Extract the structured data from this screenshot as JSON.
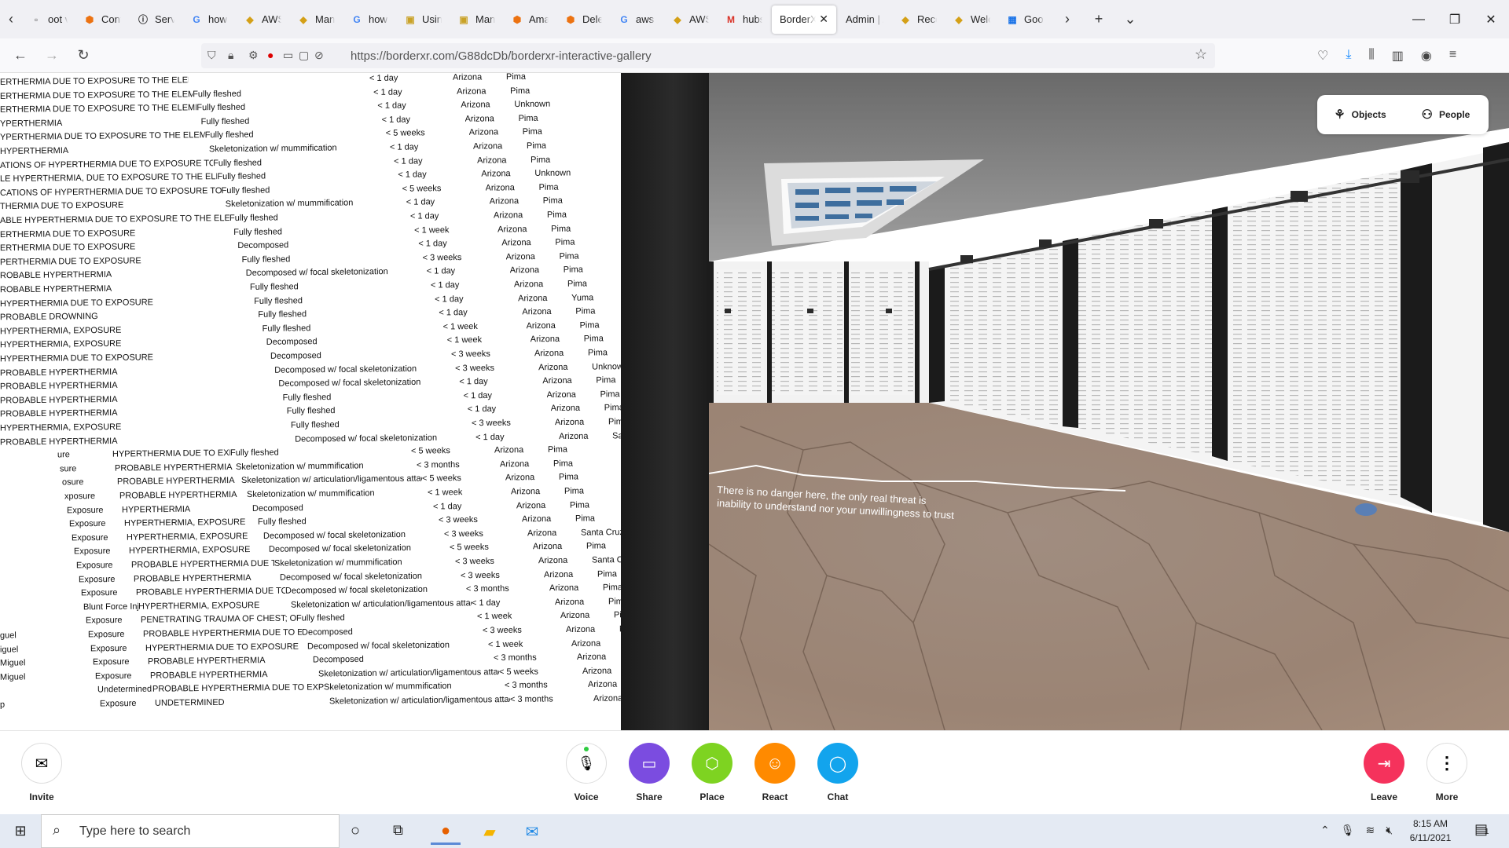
{
  "browser": {
    "tabs": [
      {
        "label": "oot v",
        "icon": "page-icon",
        "color": "#555"
      },
      {
        "label": "Conte",
        "icon": "aws-cube-icon",
        "color": "#ec7211"
      },
      {
        "label": "Server",
        "icon": "info-icon",
        "color": "#333"
      },
      {
        "label": "how t",
        "icon": "google-icon",
        "color": "#4285f4"
      },
      {
        "label": "AWS T",
        "icon": "bird-icon",
        "color": "#d4a017"
      },
      {
        "label": "Mana",
        "icon": "bird-icon",
        "color": "#d4a017"
      },
      {
        "label": "how t",
        "icon": "google-icon",
        "color": "#4285f4"
      },
      {
        "label": "Using",
        "icon": "book-icon",
        "color": "#c9a227"
      },
      {
        "label": "Manag",
        "icon": "book-icon",
        "color": "#c9a227"
      },
      {
        "label": "Amaz",
        "icon": "aws-cube-icon",
        "color": "#ec7211"
      },
      {
        "label": "Delete",
        "icon": "aws-cube-icon",
        "color": "#ec7211"
      },
      {
        "label": "aws cl",
        "icon": "google-icon",
        "color": "#4285f4"
      },
      {
        "label": "AWS T",
        "icon": "bird-icon",
        "color": "#d4a017"
      },
      {
        "label": "hubs",
        "icon": "gmail-icon",
        "color": "#d93025"
      },
      {
        "label": "BorderX",
        "icon": "none",
        "color": "#333",
        "active": true
      },
      {
        "label": "Admin | A",
        "icon": "none",
        "color": "#333"
      },
      {
        "label": "Recon",
        "icon": "bird-icon",
        "color": "#d4a017"
      },
      {
        "label": "Welco",
        "icon": "bird-icon",
        "color": "#d4a017"
      },
      {
        "label": "Googl",
        "icon": "calendar-icon",
        "color": "#1a73e8"
      }
    ],
    "url": "https://borderxr.com/G88dcDb/borderxr-interactive-gallery"
  },
  "listing": {
    "rows": [
      [
        "ERTHERMIA DUE TO EXPOSURE TO THE ELEMENTS",
        "",
        "< 1 day",
        "Arizona",
        "Pima"
      ],
      [
        "ERTHERMIA DUE TO EXPOSURE TO THE ELEMENTS",
        "Fully fleshed",
        "< 1 day",
        "Arizona",
        "Pima"
      ],
      [
        "ERTHERMIA DUE TO EXPOSURE TO THE ELEMENTS",
        "Fully fleshed",
        "< 1 day",
        "Arizona",
        "Unknown"
      ],
      [
        "YPERTHERMIA",
        "Fully fleshed",
        "< 1 day",
        "Arizona",
        "Pima"
      ],
      [
        "YPERTHERMIA DUE TO EXPOSURE TO THE ELEMENTS",
        "Fully fleshed",
        "< 5 weeks",
        "Arizona",
        "Pima"
      ],
      [
        "HYPERTHERMIA",
        "Skeletonization w/ mummification",
        "< 1 day",
        "Arizona",
        "Pima"
      ],
      [
        "ATIONS OF HYPERTHERMIA DUE TO EXPOSURE TO THE ELEM",
        "Fully fleshed",
        "< 1 day",
        "Arizona",
        "Pima"
      ],
      [
        "LE HYPERTHERMIA, DUE TO EXPOSURE TO THE ELEMENTS",
        "Fully fleshed",
        "< 1 day",
        "Arizona",
        "Unknown"
      ],
      [
        "CATIONS OF HYPERTHERMIA DUE TO EXPOSURE TO THE ELEM",
        "Fully fleshed",
        "< 5 weeks",
        "Arizona",
        "Pima"
      ],
      [
        "THERMIA DUE TO EXPOSURE",
        "Skeletonization w/ mummification",
        "< 1 day",
        "Arizona",
        "Pima"
      ],
      [
        "ABLE HYPERTHERMIA DUE TO EXPOSURE TO THE ELEMENTS",
        "Fully fleshed",
        "< 1 day",
        "Arizona",
        "Pima"
      ],
      [
        "ERTHERMIA DUE TO EXPOSURE",
        "Fully fleshed",
        "< 1 week",
        "Arizona",
        "Pima"
      ],
      [
        "ERTHERMIA DUE TO EXPOSURE",
        "Decomposed",
        "< 1 day",
        "Arizona",
        "Pima"
      ],
      [
        "PERTHERMIA DUE TO EXPOSURE",
        "Fully fleshed",
        "< 3 weeks",
        "Arizona",
        "Pima"
      ],
      [
        "ROBABLE HYPERTHERMIA",
        "Decomposed w/ focal skeletonization",
        "< 1 day",
        "Arizona",
        "Pima"
      ],
      [
        "ROBABLE HYPERTHERMIA",
        "Fully fleshed",
        "< 1 day",
        "Arizona",
        "Pima"
      ],
      [
        "HYPERTHERMIA DUE TO EXPOSURE",
        "Fully fleshed",
        "< 1 day",
        "Arizona",
        "Yuma"
      ],
      [
        "PROBABLE DROWNING",
        "Fully fleshed",
        "< 1 day",
        "Arizona",
        "Pima"
      ],
      [
        "HYPERTHERMIA, EXPOSURE",
        "Fully fleshed",
        "< 1 week",
        "Arizona",
        "Pima"
      ],
      [
        "HYPERTHERMIA, EXPOSURE",
        "Decomposed",
        "< 1 week",
        "Arizona",
        "Pima"
      ],
      [
        "HYPERTHERMIA DUE TO EXPOSURE",
        "Decomposed",
        "< 3 weeks",
        "Arizona",
        "Pima"
      ],
      [
        "PROBABLE HYPERTHERMIA",
        "Decomposed w/ focal skeletonization",
        "< 3 weeks",
        "Arizona",
        "Unknown"
      ],
      [
        "PROBABLE HYPERTHERMIA",
        "Decomposed w/ focal skeletonization",
        "< 1 day",
        "Arizona",
        "Pima"
      ],
      [
        "PROBABLE HYPERTHERMIA",
        "Fully fleshed",
        "< 1 day",
        "Arizona",
        "Pima"
      ],
      [
        "PROBABLE HYPERTHERMIA",
        "Fully fleshed",
        "< 1 day",
        "Arizona",
        "Pima"
      ],
      [
        "HYPERTHERMIA, EXPOSURE",
        "Fully fleshed",
        "< 3 weeks",
        "Arizona",
        "Pima"
      ],
      [
        "PROBABLE HYPERTHERMIA",
        "Decomposed w/ focal skeletonization",
        "< 1 day",
        "Arizona",
        "Santa Cruz"
      ],
      [
        "HYPERTHERMIA DUE TO EXPOSURE",
        "Fully fleshed",
        "< 5 weeks",
        "Arizona",
        "Pima"
      ],
      [
        "PROBABLE HYPERTHERMIA",
        "Skeletonization w/ mummification",
        "< 3 months",
        "Arizona",
        "Pima"
      ],
      [
        "PROBABLE HYPERTHERMIA",
        "Skeletonization w/ articulation/ligamentous attac",
        "< 5 weeks",
        "Arizona",
        "Pima"
      ],
      [
        "PROBABLE HYPERTHERMIA",
        "Skeletonization w/ mummification",
        "< 1 week",
        "Arizona",
        "Pima"
      ],
      [
        "HYPERTHERMIA",
        "Decomposed",
        "< 1 day",
        "Arizona",
        "Pima"
      ],
      [
        "HYPERTHERMIA, EXPOSURE",
        "Fully fleshed",
        "< 3 weeks",
        "Arizona",
        "Pima"
      ],
      [
        "HYPERTHERMIA, EXPOSURE",
        "Decomposed w/ focal skeletonization",
        "< 3 weeks",
        "Arizona",
        "Santa Cruz"
      ],
      [
        "HYPERTHERMIA, EXPOSURE",
        "Decomposed w/ focal skeletonization",
        "< 5 weeks",
        "Arizona",
        "Pima"
      ],
      [
        "PROBABLE HYPERTHERMIA DUE TO EXPOSURE TO THE ELEMENTS",
        "Skeletonization w/ mummification",
        "< 3 weeks",
        "Arizona",
        "Santa Cruz"
      ],
      [
        "PROBABLE HYPERTHERMIA",
        "Decomposed w/ focal skeletonization",
        "< 3 weeks",
        "Arizona",
        "Pima"
      ],
      [
        "PROBABLE HYPERTHERMIA DUE TO EXPOSURE TO THE ELEMENTS",
        "Decomposed w/ focal skeletonization",
        "< 3 months",
        "Arizona",
        "Pima"
      ],
      [
        "HYPERTHERMIA, EXPOSURE",
        "Skeletonization w/ articulation/ligamentous attac",
        "< 1 day",
        "Arizona",
        "Pima"
      ],
      [
        "PENETRATING TRAUMA OF CHEST; OTHER SIG.: BLUNT TRAUMA OF H",
        "Fully fleshed",
        "< 1 week",
        "Arizona",
        "Pinal"
      ],
      [
        "PROBABLE HYPERTHERMIA DUE TO EXPOSURE TO THE ELEMENTS",
        "Decomposed",
        "< 3 weeks",
        "Arizona",
        "Pima"
      ],
      [
        "HYPERTHERMIA DUE TO EXPOSURE",
        "Decomposed w/ focal skeletonization",
        "< 1 week",
        "Arizona",
        "Pima"
      ],
      [
        "PROBABLE HYPERTHERMIA",
        "Decomposed",
        "< 3 months",
        "Arizona",
        "Pima"
      ],
      [
        "PROBABLE HYPERTHERMIA",
        "Skeletonization w/ articulation/ligamentous attac",
        "< 5 weeks",
        "Arizona",
        "Pima"
      ],
      [
        "PROBABLE HYPERTHERMIA DUE TO EXPOSURE TO THE ELEMENTS",
        "Skeletonization w/ mummification",
        "< 3 months",
        "Arizona",
        "Pima"
      ],
      [
        "UNDETERMINED",
        "Skeletonization w/ articulation/ligamentous attac",
        "< 3 months",
        "Arizona",
        "Pima"
      ]
    ],
    "prefix_col": [
      "",
      "",
      "",
      "",
      "",
      "",
      "",
      "",
      "",
      "",
      "",
      "",
      "",
      "",
      "",
      "",
      "",
      "",
      "",
      "",
      "",
      "",
      "",
      "",
      "",
      "",
      "",
      "ure",
      "sure",
      "osure",
      "xposure",
      "Exposure",
      "Exposure",
      "Exposure",
      "Exposure",
      "Exposure",
      "Exposure",
      "Exposure",
      "Blunt Force Injury",
      "Exposure",
      "Exposure",
      "Exposure",
      "Exposure",
      "Exposure",
      "Undetermined",
      "Exposure"
    ],
    "county_col": [
      "",
      "",
      "",
      "",
      "",
      "",
      "",
      "",
      "",
      "",
      "",
      "",
      "",
      "",
      "",
      "",
      "",
      "",
      "",
      "",
      "",
      "",
      "",
      "",
      "",
      "",
      "",
      "",
      "",
      "",
      "",
      "",
      "",
      "",
      "",
      "",
      "",
      "",
      "",
      "",
      "guel",
      "iguel",
      "Miguel",
      "Miguel",
      "",
      "p"
    ]
  },
  "room": {
    "floor_text_line1": "There is no danger here, the only real threat is",
    "floor_text_line2": "inability to understand nor your unwillingness to trust"
  },
  "overlay": {
    "objects_label": "Objects",
    "people_label": "People"
  },
  "toolbar": {
    "invite_label": "Invite",
    "voice_label": "Voice",
    "share_label": "Share",
    "place_label": "Place",
    "react_label": "React",
    "chat_label": "Chat",
    "leave_label": "Leave",
    "more_label": "More",
    "colors": {
      "share": "#7b4ce0",
      "place": "#7ed321",
      "react": "#ff8a00",
      "chat": "#12a4ed",
      "leave": "#f5325c"
    }
  },
  "taskbar": {
    "search_placeholder": "Type here to search",
    "time": "8:15 AM",
    "date": "6/11/2021",
    "notification_count": "1"
  }
}
